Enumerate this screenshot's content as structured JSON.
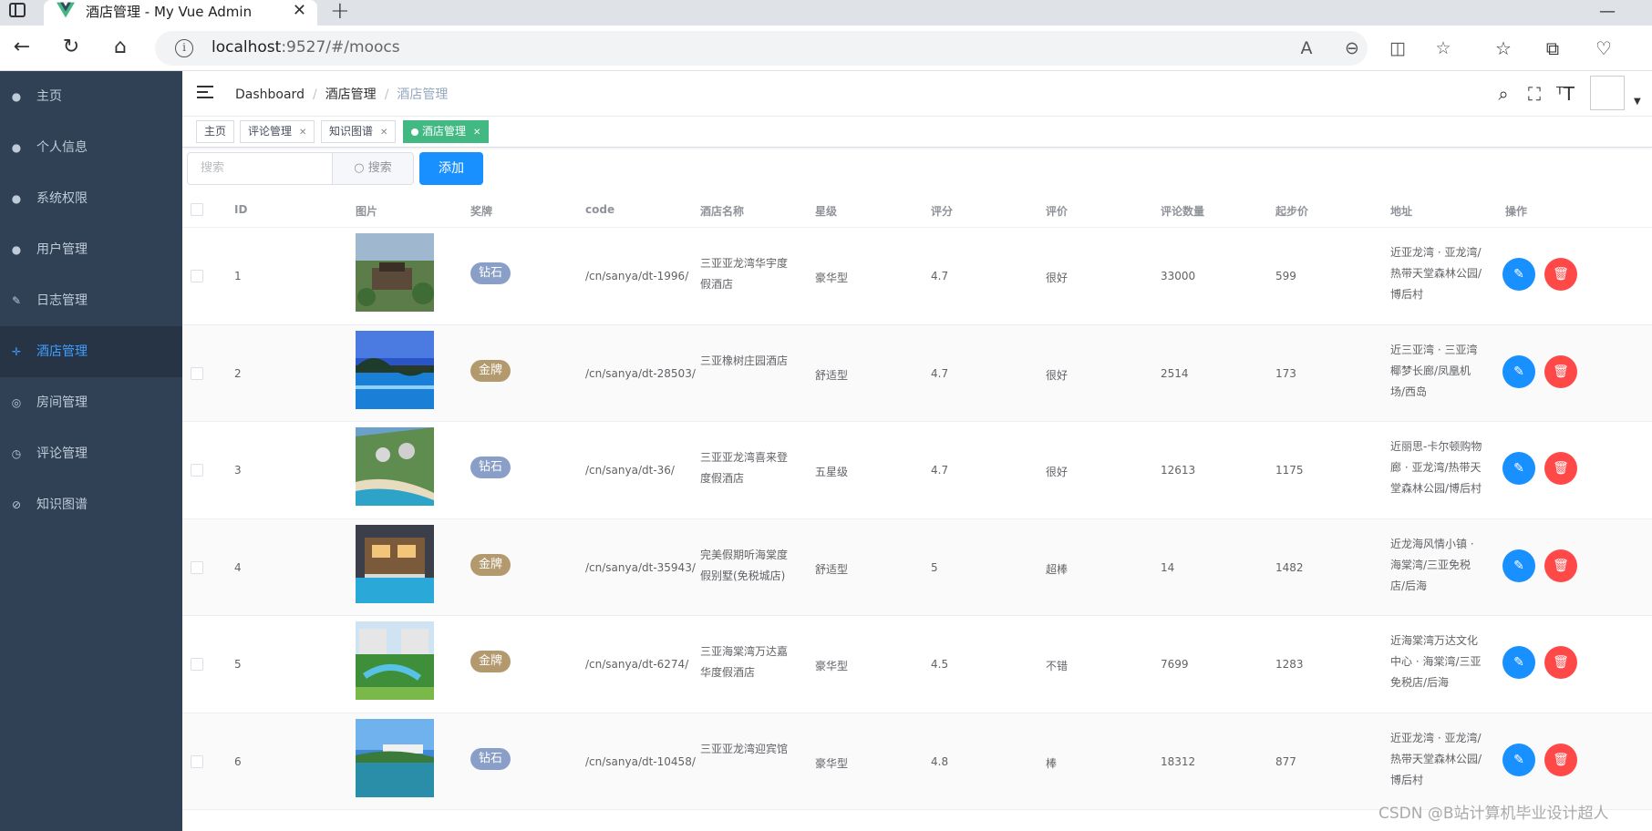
{
  "browser": {
    "tab_title": "酒店管理 - My Vue Admin",
    "url_host": "localhost",
    "url_rest": ":9527/#/moocs"
  },
  "sidebar": {
    "items": [
      {
        "label": "主页",
        "icon": "dashboard-icon"
      },
      {
        "label": "个人信息",
        "icon": "user-icon"
      },
      {
        "label": "系统权限",
        "icon": "user-lock-icon"
      },
      {
        "label": "用户管理",
        "icon": "users-icon"
      },
      {
        "label": "日志管理",
        "icon": "feather-icon"
      },
      {
        "label": "酒店管理",
        "icon": "arrows-icon",
        "active": true
      },
      {
        "label": "房间管理",
        "icon": "map-pin-icon"
      },
      {
        "label": "评论管理",
        "icon": "clock-icon"
      },
      {
        "label": "知识图谱",
        "icon": "compass-icon"
      }
    ]
  },
  "breadcrumb": [
    "Dashboard",
    "酒店管理",
    "酒店管理"
  ],
  "tags": [
    {
      "label": "主页",
      "closable": false
    },
    {
      "label": "评论管理",
      "closable": true
    },
    {
      "label": "知识图谱",
      "closable": true
    },
    {
      "label": "酒店管理",
      "closable": true,
      "active": true
    }
  ],
  "toolbar": {
    "search_placeholder": "搜索",
    "search_button": "搜索",
    "add_button": "添加"
  },
  "table": {
    "columns": [
      "ID",
      "图片",
      "奖牌",
      "code",
      "酒店名称",
      "星级",
      "评分",
      "评价",
      "评论数量",
      "起步价",
      "地址",
      "操作"
    ],
    "rows": [
      {
        "id": "1",
        "medal": "钻石",
        "code": "/cn/sanya/dt-1996/",
        "name": "三亚亚龙湾华宇度假酒店",
        "star": "豪华型",
        "score": "4.7",
        "review": "很好",
        "count": "33000",
        "price": "599",
        "address": "近亚龙湾 · 亚龙湾/热带天堂森林公园/博后村",
        "img": "resort"
      },
      {
        "id": "2",
        "medal": "金牌",
        "code": "/cn/sanya/dt-28503/",
        "name": "三亚橡树庄园酒店",
        "star": "舒适型",
        "score": "4.7",
        "review": "很好",
        "count": "2514",
        "price": "173",
        "address": "近三亚湾 · 三亚湾椰梦长廊/凤凰机场/西岛",
        "img": "pool-night"
      },
      {
        "id": "3",
        "medal": "钻石",
        "code": "/cn/sanya/dt-36/",
        "name": "三亚亚龙湾喜来登度假酒店",
        "star": "五星级",
        "score": "4.7",
        "review": "很好",
        "count": "12613",
        "price": "1175",
        "address": "近丽思-卡尔顿购物廊 · 亚龙湾/热带天堂森林公园/博后村",
        "img": "beach"
      },
      {
        "id": "4",
        "medal": "金牌",
        "code": "/cn/sanya/dt-35943/",
        "name": "完美假期听海棠度假别墅(免税城店)",
        "star": "舒适型",
        "score": "5",
        "review": "超棒",
        "count": "14",
        "price": "1482",
        "address": "近龙海风情小镇 · 海棠湾/三亚免税店/后海",
        "img": "villa"
      },
      {
        "id": "5",
        "medal": "金牌",
        "code": "/cn/sanya/dt-6274/",
        "name": "三亚海棠湾万达嘉华度假酒店",
        "star": "豪华型",
        "score": "4.5",
        "review": "不错",
        "count": "7699",
        "price": "1283",
        "address": "近海棠湾万达文化中心 · 海棠湾/三亚免税店/后海",
        "img": "garden"
      },
      {
        "id": "6",
        "medal": "钻石",
        "code": "/cn/sanya/dt-10458/",
        "name": "三亚亚龙湾迎宾馆",
        "star": "豪华型",
        "score": "4.8",
        "review": "棒",
        "count": "18312",
        "price": "877",
        "address": "近亚龙湾 · 亚龙湾/热带天堂森林公园/博后村",
        "img": "bay"
      }
    ]
  },
  "colors": {
    "sidebar_bg": "#304156",
    "sidebar_active": "#409eff",
    "tag_active": "#42b983",
    "primary": "#1890ff",
    "danger": "#ff4949",
    "medal_diamond": "#8a9fc7",
    "medal_gold": "#b39a6e"
  },
  "watermark": "CSDN @B站计算机毕业设计超人"
}
